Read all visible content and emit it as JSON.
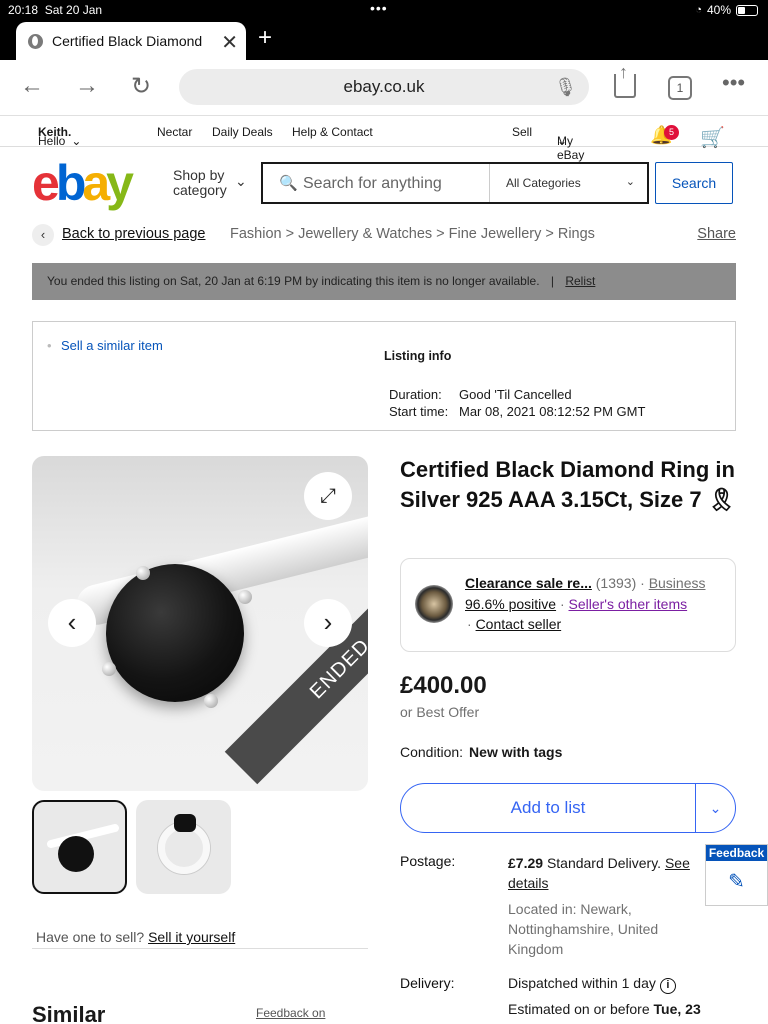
{
  "status": {
    "time": "20:18",
    "date": "Sat 20 Jan",
    "battery": "40%"
  },
  "browser": {
    "tab_title": "Certified Black Diamond",
    "url": "ebay.co.uk",
    "tab_count": "1"
  },
  "topnav": {
    "hello_prefix": "Hello",
    "hello_name": "Keith.",
    "nectar": "Nectar",
    "daily_deals": "Daily Deals",
    "help": "Help & Contact",
    "sell": "Sell",
    "my_ebay": "My eBay",
    "notification_count": "5"
  },
  "search": {
    "shop_by_line1": "Shop by",
    "shop_by_line2": "category",
    "placeholder": "Search for anything",
    "category": "All Categories",
    "button": "Search"
  },
  "breadcrumb": {
    "back": "Back to previous page",
    "path": "Fashion > Jewellery & Watches > Fine Jewellery > Rings",
    "share": "Share"
  },
  "ended_banner": {
    "text": "You ended this listing on Sat, 20 Jan at 6:19 PM by indicating this item is no longer available.",
    "separator": "|",
    "relist": "Relist"
  },
  "listing_info": {
    "sell_similar": "Sell a similar item",
    "title": "Listing info",
    "duration_label": "Duration:",
    "duration_value": "Good 'Til Cancelled",
    "start_label": "Start time:",
    "start_value": "Mar 08, 2021 08:12:52 PM GMT"
  },
  "gallery": {
    "ended_label": "ENDED",
    "have_one": "Have one to sell?",
    "sell_it": "Sell it yourself"
  },
  "product": {
    "title": "Certified Black Diamond Ring in Silver 925 AAA 3.15Ct, Size 7 🎗",
    "seller_name": "Clearance sale re...",
    "seller_count": "(1393)",
    "seller_dot": "·",
    "seller_type": "Business",
    "seller_positive": "96.6% positive",
    "seller_other": "Seller's other items",
    "contact": "Contact seller",
    "price": "£400.00",
    "best_offer": "or Best Offer",
    "condition_label": "Condition:",
    "condition_value": "New with tags",
    "add_to_list": "Add to list",
    "postage_label": "Postage:",
    "postage_price": "£7.29",
    "postage_type": "Standard Delivery.",
    "postage_see": "See",
    "postage_details": "details",
    "located": "Located in: Newark, Nottinghamshire, United Kingdom",
    "delivery_label": "Delivery:",
    "dispatch": "Dispatched within 1 day",
    "estimated_prefix": "Estimated on or before",
    "estimated_date": "Tue, 23"
  },
  "similar": {
    "heading": "Similar",
    "feedback_on": "Feedback on"
  },
  "feedback_tab": {
    "label": "Feedback"
  }
}
